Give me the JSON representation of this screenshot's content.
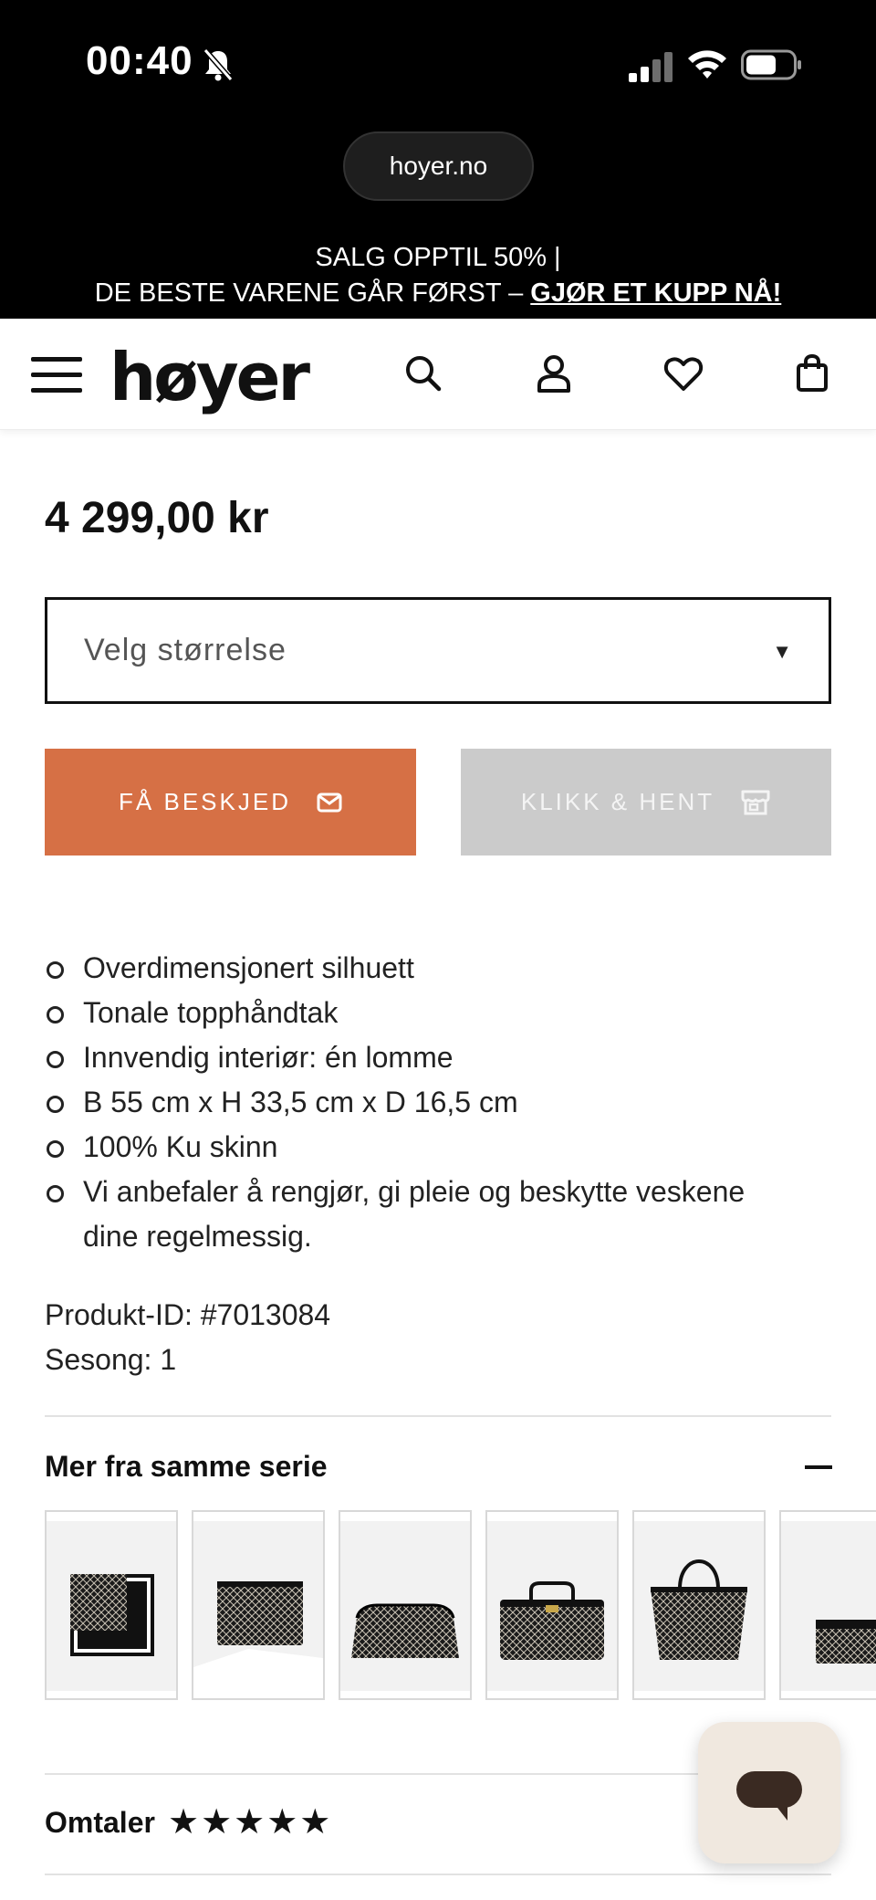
{
  "status_bar": {
    "time": "00:40"
  },
  "browser": {
    "url": "hoyer.no"
  },
  "promo": {
    "line1": "SALG OPPTIL 50%  |",
    "line2_prefix": "DE BESTE VARENE GÅR FØRST – ",
    "line2_link": "GJØR ET KUPP NÅ!"
  },
  "header": {
    "logo_text": "høyer",
    "icons": [
      "menu-icon",
      "search-icon",
      "account-icon",
      "wishlist-heart-icon",
      "shopping-bag-icon"
    ]
  },
  "product": {
    "price": "4 299,00 kr",
    "size_select": {
      "placeholder": "Velg størrelse"
    },
    "notify_button": "FÅ BESKJED",
    "click_collect_button": "KLIKK & HENT",
    "details": [
      "Overdimensjonert silhuett",
      "Tonale topphåndtak",
      "Innvendig interiør: én lomme",
      "B 55 cm x H 33,5 cm x D 16,5 cm",
      "100% Ku skinn",
      "Vi anbefaler å rengjør, gi pleie og beskytte veskene dine regelmessig."
    ],
    "product_id": "Produkt-ID: #7013084",
    "season": "Sesong: 1"
  },
  "series": {
    "title": "Mer fra samme serie",
    "items": [
      "scarf",
      "laptop-sleeve",
      "cosmetic-pouch",
      "vanity-case",
      "tote-bag",
      "card-holder"
    ]
  },
  "reviews": {
    "title": "Omtaler",
    "stars": "★★★★★"
  },
  "colors": {
    "accent": "#d67045",
    "disabled": "#cbcbcb",
    "chat_bg": "#f0e8df"
  }
}
